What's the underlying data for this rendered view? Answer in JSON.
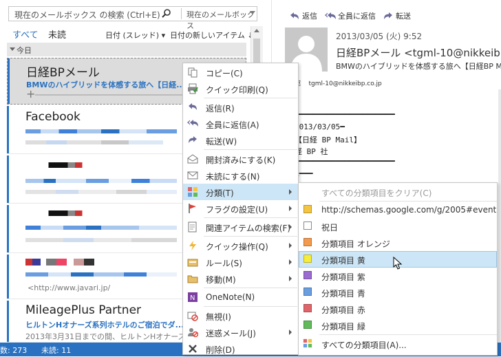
{
  "search": {
    "placeholder": "現在のメールボックス の検索 (Ctrl+E)",
    "scope": "現在のメールボックス"
  },
  "filter": {
    "all": "すべて",
    "unread": "未読",
    "sort_by": "日付 (スレッド)",
    "sort_order": "日付の新しいアイテム ↓"
  },
  "group": {
    "today": "今日"
  },
  "mails": [
    {
      "sender": "日経BPメール",
      "subject": "BMWのハイブリッドを体感する旅へ【日経...",
      "preview": ""
    },
    {
      "sender": "Facebook",
      "subject": "",
      "preview": ""
    },
    {
      "sender": "",
      "subject": "",
      "preview": ""
    },
    {
      "sender": "",
      "subject": "",
      "preview": ""
    },
    {
      "sender": "",
      "subject": "",
      "preview": "<http://www.javari.jp/"
    },
    {
      "sender": "MileagePlus Partner",
      "subject": "ヒルトンHオナーズ系列ホテルのご宿泊でダ...",
      "preview": "2013年3月31日までの間、ヒルトンHオナーズ"
    }
  ],
  "status": {
    "items": "数: 273",
    "unread": "未読: 11"
  },
  "reading": {
    "reply": "返信",
    "reply_all": "全員に返信",
    "forward": "転送",
    "date": "2013/03/05 (火) 9:52",
    "from": "日経BPメール <tgml-10@nikkeibp.c",
    "subject": "BMWのハイブリッドを体感する旅へ【日経BP Mail】",
    "to_label": "宛",
    "to": "tgml-10@nikkeibp.co.jp",
    "body": [
      "━━━━━━━━━━━━━━━━━━━━━━",
      "2013/03/05━",
      "  【日経 BP Mail】",
      "経 BP 社",
      "━━━━━━━━━━━━━━━━━━━━━━",
      "R━━━"
    ]
  },
  "context_menu": {
    "items": [
      {
        "label": "コピー(C)",
        "icon": "copy-icon"
      },
      {
        "label": "クイック印刷(Q)",
        "icon": "print-icon"
      },
      {
        "label": "返信(R)",
        "icon": "reply-icon"
      },
      {
        "label": "全員に返信(A)",
        "icon": "reply-all-icon"
      },
      {
        "label": "転送(W)",
        "icon": "forward-icon"
      },
      {
        "label": "開封済みにする(K)",
        "icon": "read-icon"
      },
      {
        "label": "未読にする(N)",
        "icon": "unread-icon"
      },
      {
        "label": "分類(T)",
        "icon": "categorize-icon"
      },
      {
        "label": "フラグの設定(U)",
        "icon": "flag-icon"
      },
      {
        "label": "関連アイテムの検索(F)",
        "icon": "related-icon"
      },
      {
        "label": "クイック操作(Q)",
        "icon": "quick-steps-icon"
      },
      {
        "label": "ルール(S)",
        "icon": "rules-icon"
      },
      {
        "label": "移動(M)",
        "icon": "move-icon"
      },
      {
        "label": "OneNote(N)",
        "icon": "onenote-icon"
      },
      {
        "label": "無視(I)",
        "icon": "ignore-icon"
      },
      {
        "label": "迷惑メール(J)",
        "icon": "junk-icon"
      },
      {
        "label": "削除(D)",
        "icon": "delete-icon"
      }
    ]
  },
  "submenu": {
    "items": [
      {
        "label": "すべての分類項目をクリア(C)",
        "color": ""
      },
      {
        "label": "http://schemas.google.com/g/2005#event",
        "color": "#f4c542"
      },
      {
        "label": "祝日",
        "color": "#ffffff"
      },
      {
        "label": "分類項目 オレンジ",
        "color": "#f49a4c"
      },
      {
        "label": "分類項目 黄",
        "color": "#f6ec3a"
      },
      {
        "label": "分類項目 紫",
        "color": "#9a6bd1"
      },
      {
        "label": "分類項目 青",
        "color": "#6a9ee0"
      },
      {
        "label": "分類項目 赤",
        "color": "#e0656b"
      },
      {
        "label": "分類項目 緑",
        "color": "#62bb5a"
      },
      {
        "label": "すべての分類項目(A)...",
        "color": ""
      }
    ]
  },
  "colors": {
    "accent": "#2a72c1",
    "highlight": "#cde6f7"
  }
}
